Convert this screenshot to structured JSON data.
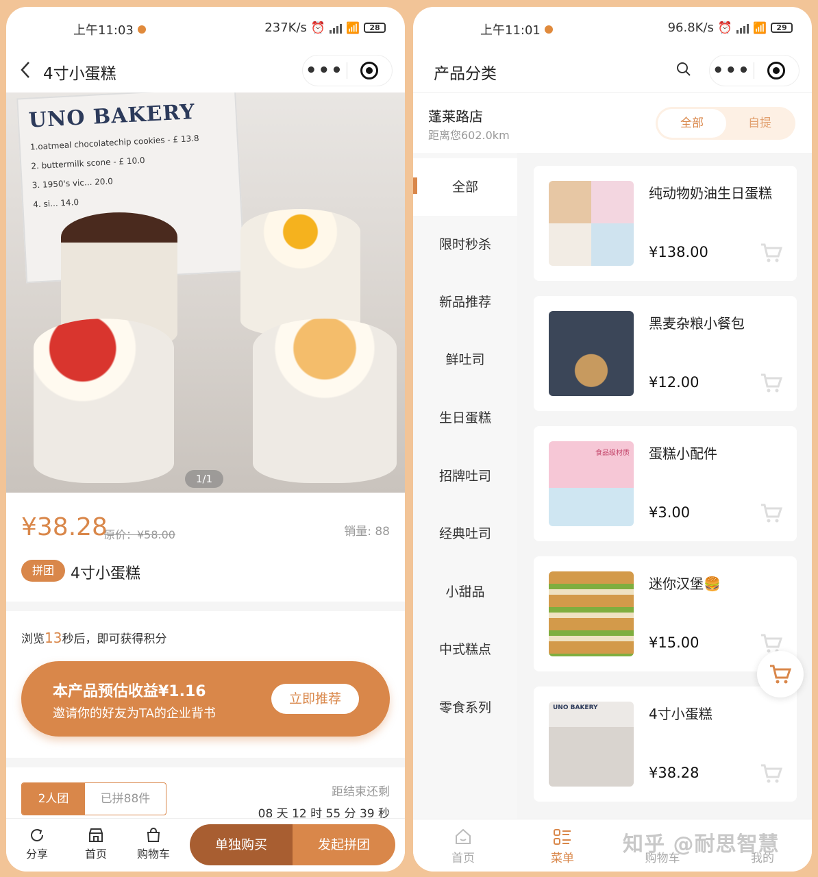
{
  "left": {
    "status": {
      "time": "上午11:03",
      "speed": "237K/s",
      "battery": "28"
    },
    "nav": {
      "back_icon": "chevron-left-icon",
      "title": "4寸小蛋糕"
    },
    "hero": {
      "brand": "UNO BAKERY",
      "menu_lines": [
        "1.oatmeal chocolatechip cookies - £ 13.8",
        "2. buttermilk scone - £ 10.0",
        "3. 1950's vic...  20.0",
        "4. si...  14.0"
      ],
      "counter": "1/1"
    },
    "price": {
      "current": "¥38.28",
      "original": "原价：¥58.00",
      "sales": "销量: 88"
    },
    "product": {
      "badge": "拼团",
      "name": "4寸小蛋糕"
    },
    "browse": {
      "prefix": "浏览",
      "seconds": "13",
      "suffix": "秒后，即可获得积分"
    },
    "promo": {
      "title": "本产品预估收益¥1.16",
      "subtitle": "邀请你的好友为TA的企业背书",
      "button": "立即推荐"
    },
    "team": {
      "active_tab": "2人团",
      "other_tab": "已拼88件",
      "countdown_label": "距结束还剩",
      "countdown": "08 天 12 时 55 分 39 秒"
    },
    "bottom": {
      "share": "分享",
      "home": "首页",
      "cart": "购物车",
      "buy_single": "单独购买",
      "buy_group": "发起拼团"
    }
  },
  "right": {
    "status": {
      "time": "上午11:01",
      "speed": "96.8K/s",
      "battery": "29"
    },
    "header": {
      "title": "产品分类"
    },
    "store": {
      "name": "蓬莱路店",
      "distance": "距离您602.0km",
      "toggle_on": "全部",
      "toggle_off": "自提"
    },
    "categories": [
      "全部",
      "限时秒杀",
      "新品推荐",
      "鲜吐司",
      "生日蛋糕",
      "招牌吐司",
      "经典吐司",
      "小甜品",
      "中式糕点",
      "零食系列"
    ],
    "products": [
      {
        "name": "纯动物奶油生日蛋糕",
        "price": "¥138.00"
      },
      {
        "name": "黑麦杂粮小餐包",
        "price": "¥12.00"
      },
      {
        "name": "蛋糕小配件",
        "price": "¥3.00"
      },
      {
        "name": "迷你汉堡🍔",
        "price": "¥15.00"
      },
      {
        "name": "4寸小蛋糕",
        "price": "¥38.28"
      }
    ],
    "thumb_text": {
      "accessory": "食品级材质",
      "cake": "UNO BAKERY"
    },
    "tabbar": {
      "home": "首页",
      "menu": "菜单",
      "cart": "购物车",
      "mine": "我的"
    },
    "watermark": "知乎 @耐思智慧"
  },
  "colors": {
    "accent": "#d9874a",
    "accent_dark": "#a85e31",
    "page_bg": "#f2c497"
  }
}
